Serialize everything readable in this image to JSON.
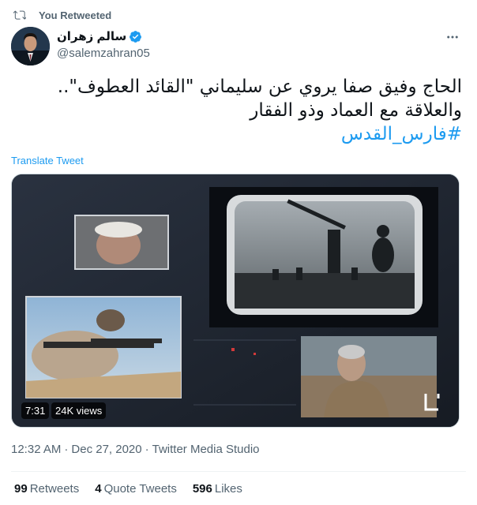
{
  "retweet": {
    "label": "You Retweeted"
  },
  "user": {
    "display_name": "سالم زهران",
    "handle": "@salemzahran05",
    "verified": true
  },
  "tweet": {
    "line1": "الحاج وفيق صفا يروي عن سليماني \"القائد العطوف\"..",
    "line2": "والعلاقة مع العماد وذو الفقار",
    "hashtag": "#فارس_القدس"
  },
  "translate_label": "Translate Tweet",
  "media": {
    "duration": "7:31",
    "views": "24K views"
  },
  "meta": {
    "time": "12:32 AM",
    "separator1": "·",
    "date": "Dec 27, 2020",
    "separator2": "·",
    "source": "Twitter Media Studio"
  },
  "stats": {
    "retweets_count": "99",
    "retweets_label": "Retweets",
    "quotes_count": "4",
    "quotes_label": "Quote Tweets",
    "likes_count": "596",
    "likes_label": "Likes"
  },
  "colors": {
    "accent": "#1d9bf0",
    "muted": "#536471",
    "text": "#0f1419"
  },
  "icons": [
    "retweet-icon",
    "verified-badge-icon",
    "more-icon"
  ]
}
